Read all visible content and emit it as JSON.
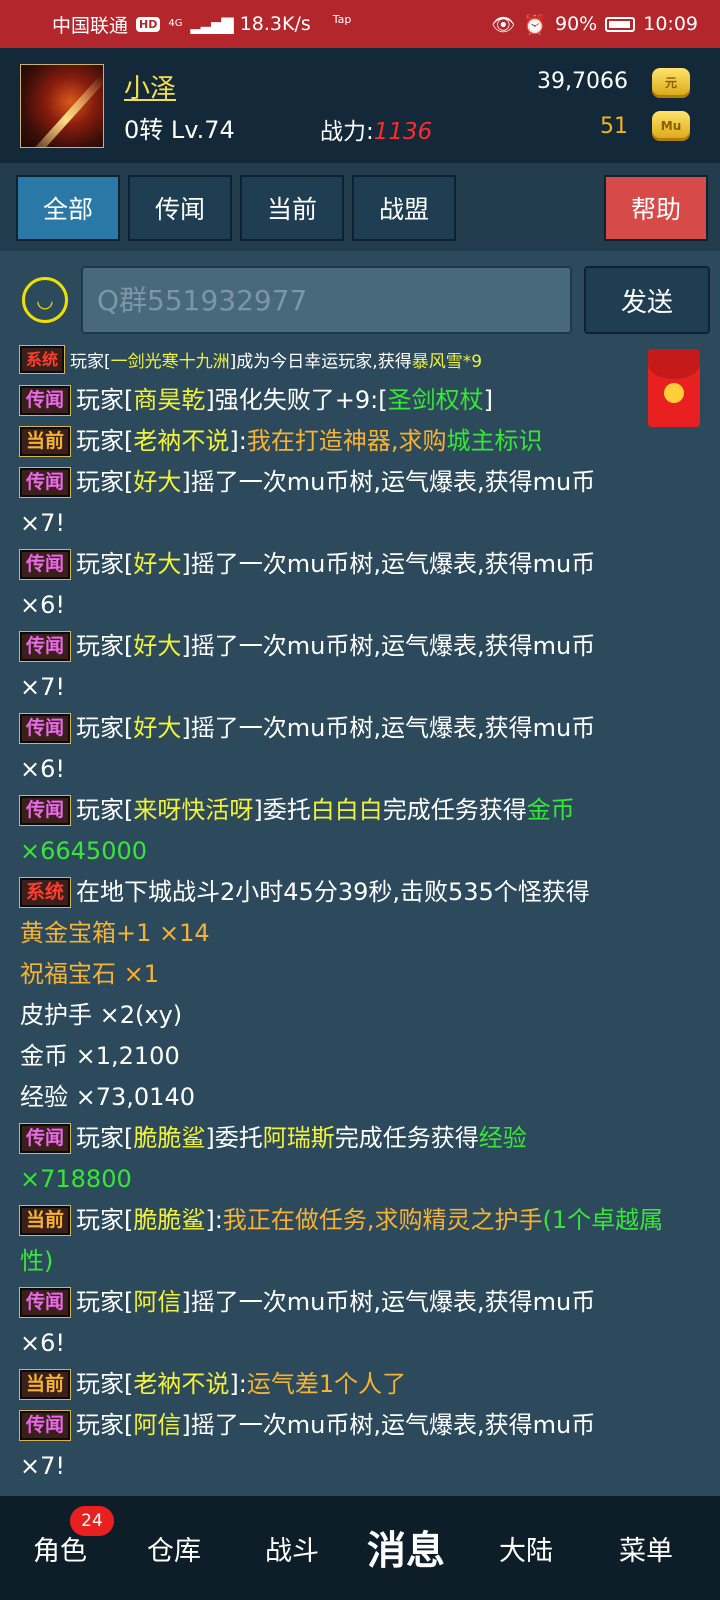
{
  "status_bar": {
    "carrier": "中国联通",
    "hd": "HD",
    "network": "4G",
    "speed": "18.3K/s",
    "tap": "Tap",
    "battery": "90%",
    "time": "10:09"
  },
  "player": {
    "name": "小泽",
    "level": "0转 Lv.74",
    "power_label": "战力:",
    "power_value": "1136",
    "gold": "39,7066",
    "mu": "51",
    "gold_icon_text": "元",
    "mu_icon_text": "Mu"
  },
  "tabs": [
    {
      "label": "全部",
      "active": true
    },
    {
      "label": "传闻",
      "active": false
    },
    {
      "label": "当前",
      "active": false
    },
    {
      "label": "战盟",
      "active": false
    }
  ],
  "help_label": "帮助",
  "chat": {
    "placeholder": "Q群551932977",
    "send_label": "发送"
  },
  "badges": {
    "system": "系统",
    "rumor": "传闻",
    "current": "当前"
  },
  "messages": {
    "m1": {
      "prefix": "玩家[",
      "name": "一剑光寒十九洲",
      "text": "]成为今日幸运玩家,获得",
      "item": "暴风雪*9"
    },
    "m2": {
      "prefix": "玩家[",
      "name": "商昊乾",
      "text": "]强化失败了+9:[",
      "item": "圣剑权杖",
      "suffix": "]"
    },
    "m3": {
      "prefix": "玩家[",
      "name": "老衲不说",
      "text": "]:",
      "msg": "我在打造神器,求购",
      "item": "城主标识"
    },
    "m4": {
      "prefix": "玩家[",
      "name": "好大",
      "text": "]摇了一次mu币树,运气爆表,获得mu币",
      "count": "×7!"
    },
    "m5": {
      "prefix": "玩家[",
      "name": "好大",
      "text": "]摇了一次mu币树,运气爆表,获得mu币",
      "count": "×6!"
    },
    "m6": {
      "prefix": "玩家[",
      "name": "好大",
      "text": "]摇了一次mu币树,运气爆表,获得mu币",
      "count": "×7!"
    },
    "m7": {
      "prefix": "玩家[",
      "name": "好大",
      "text": "]摇了一次mu币树,运气爆表,获得mu币",
      "count": "×6!"
    },
    "m8": {
      "prefix": "玩家[",
      "name": "来呀快活呀",
      "text": "]委托",
      "npc": "白白白",
      "text2": "完成任务获得",
      "item": "金币",
      "count": "×6645000"
    },
    "m9": {
      "text": "在地下城战斗2小时45分39秒,击败535个怪获得",
      "loot1": "黄金宝箱+1 ×14",
      "loot2": "祝福宝石 ×1",
      "loot3": "皮护手 ×2(xy)",
      "loot4": "金币 ×1,2100",
      "loot5": "经验 ×73,0140"
    },
    "m10": {
      "prefix": "玩家[",
      "name": "脆脆鲨",
      "text": "]委托",
      "npc": "阿瑞斯",
      "text2": "完成任务获得",
      "item": "经验",
      "count": "×718800"
    },
    "m11": {
      "prefix": "玩家[",
      "name": "脆脆鲨",
      "text": "]:",
      "msg": "我正在做任务,求购",
      "item": "精灵之护手",
      "extra": "(1个卓越属性)"
    },
    "m12": {
      "prefix": "玩家[",
      "name": "阿信",
      "text": "]摇了一次mu币树,运气爆表,获得mu币",
      "count": "×6!"
    },
    "m13": {
      "prefix": "玩家[",
      "name": "老衲不说",
      "text": "]:",
      "msg": "运气差1个人了"
    },
    "m14": {
      "prefix": "玩家[",
      "name": "阿信",
      "text": "]摇了一次mu币树,运气爆表,获得mu币",
      "count": "×7!"
    }
  },
  "nav": {
    "role": "角色",
    "role_badge": "24",
    "warehouse": "仓库",
    "battle": "战斗",
    "messages": "消息",
    "continent": "大陆",
    "menu": "菜单"
  }
}
